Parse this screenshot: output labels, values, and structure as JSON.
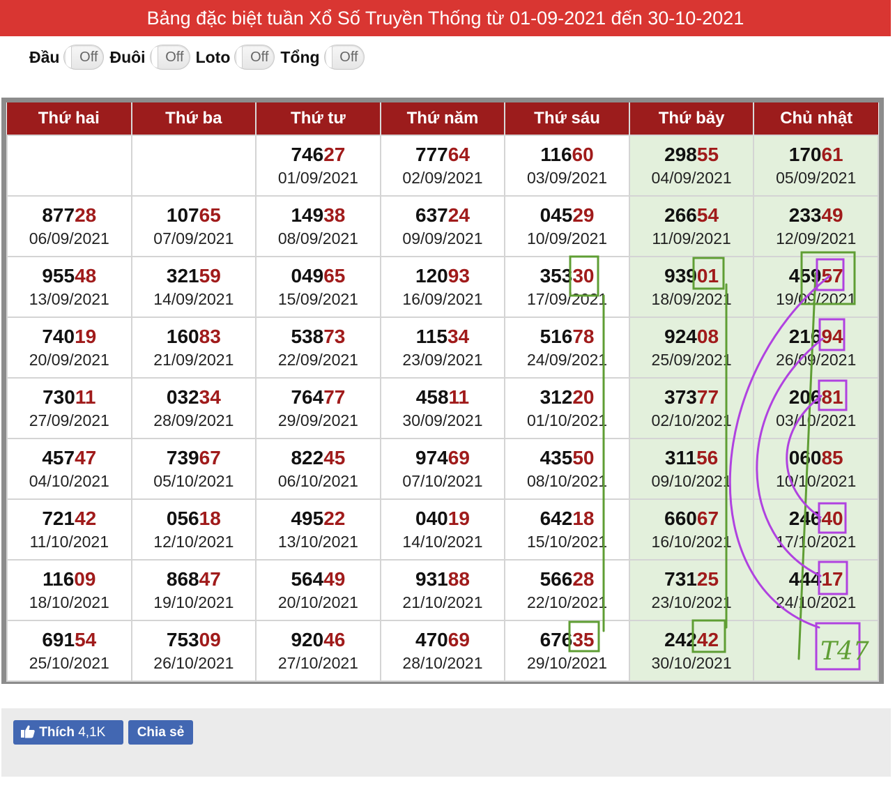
{
  "title": "Bảng đặc biệt tuần Xổ Số Truyền Thống từ 01-09-2021 đến 30-10-2021",
  "toggles": [
    {
      "label": "Đầu",
      "state": "Off"
    },
    {
      "label": "Đuôi",
      "state": "Off"
    },
    {
      "label": "Loto",
      "state": "Off"
    },
    {
      "label": "Tổng",
      "state": "Off"
    }
  ],
  "headers": [
    "Thứ hai",
    "Thứ ba",
    "Thứ tư",
    "Thứ năm",
    "Thứ sáu",
    "Thứ bảy",
    "Chủ nhật"
  ],
  "rows": [
    [
      null,
      null,
      {
        "head": "746",
        "tail": "27",
        "date": "01/09/2021"
      },
      {
        "head": "777",
        "tail": "64",
        "date": "02/09/2021"
      },
      {
        "head": "116",
        "tail": "60",
        "date": "03/09/2021"
      },
      {
        "head": "298",
        "tail": "55",
        "date": "04/09/2021"
      },
      {
        "head": "170",
        "tail": "61",
        "date": "05/09/2021"
      }
    ],
    [
      {
        "head": "877",
        "tail": "28",
        "date": "06/09/2021"
      },
      {
        "head": "107",
        "tail": "65",
        "date": "07/09/2021"
      },
      {
        "head": "149",
        "tail": "38",
        "date": "08/09/2021"
      },
      {
        "head": "637",
        "tail": "24",
        "date": "09/09/2021"
      },
      {
        "head": "045",
        "tail": "29",
        "date": "10/09/2021"
      },
      {
        "head": "266",
        "tail": "54",
        "date": "11/09/2021"
      },
      {
        "head": "233",
        "tail": "49",
        "date": "12/09/2021"
      }
    ],
    [
      {
        "head": "955",
        "tail": "48",
        "date": "13/09/2021"
      },
      {
        "head": "321",
        "tail": "59",
        "date": "14/09/2021"
      },
      {
        "head": "049",
        "tail": "65",
        "date": "15/09/2021"
      },
      {
        "head": "120",
        "tail": "93",
        "date": "16/09/2021"
      },
      {
        "head": "353",
        "tail": "30",
        "date": "17/09/2021"
      },
      {
        "head": "939",
        "tail": "01",
        "date": "18/09/2021"
      },
      {
        "head": "459",
        "tail": "57",
        "date": "19/09/2021"
      }
    ],
    [
      {
        "head": "740",
        "tail": "19",
        "date": "20/09/2021"
      },
      {
        "head": "160",
        "tail": "83",
        "date": "21/09/2021"
      },
      {
        "head": "538",
        "tail": "73",
        "date": "22/09/2021"
      },
      {
        "head": "115",
        "tail": "34",
        "date": "23/09/2021"
      },
      {
        "head": "516",
        "tail": "78",
        "date": "24/09/2021"
      },
      {
        "head": "924",
        "tail": "08",
        "date": "25/09/2021"
      },
      {
        "head": "216",
        "tail": "94",
        "date": "26/09/2021"
      }
    ],
    [
      {
        "head": "730",
        "tail": "11",
        "date": "27/09/2021"
      },
      {
        "head": "032",
        "tail": "34",
        "date": "28/09/2021"
      },
      {
        "head": "764",
        "tail": "77",
        "date": "29/09/2021"
      },
      {
        "head": "458",
        "tail": "11",
        "date": "30/09/2021"
      },
      {
        "head": "312",
        "tail": "20",
        "date": "01/10/2021"
      },
      {
        "head": "373",
        "tail": "77",
        "date": "02/10/2021"
      },
      {
        "head": "206",
        "tail": "81",
        "date": "03/10/2021"
      }
    ],
    [
      {
        "head": "457",
        "tail": "47",
        "date": "04/10/2021"
      },
      {
        "head": "739",
        "tail": "67",
        "date": "05/10/2021"
      },
      {
        "head": "822",
        "tail": "45",
        "date": "06/10/2021"
      },
      {
        "head": "974",
        "tail": "69",
        "date": "07/10/2021"
      },
      {
        "head": "435",
        "tail": "50",
        "date": "08/10/2021"
      },
      {
        "head": "311",
        "tail": "56",
        "date": "09/10/2021"
      },
      {
        "head": "060",
        "tail": "85",
        "date": "10/10/2021"
      }
    ],
    [
      {
        "head": "721",
        "tail": "42",
        "date": "11/10/2021"
      },
      {
        "head": "056",
        "tail": "18",
        "date": "12/10/2021"
      },
      {
        "head": "495",
        "tail": "22",
        "date": "13/10/2021"
      },
      {
        "head": "040",
        "tail": "19",
        "date": "14/10/2021"
      },
      {
        "head": "642",
        "tail": "18",
        "date": "15/10/2021"
      },
      {
        "head": "660",
        "tail": "67",
        "date": "16/10/2021"
      },
      {
        "head": "246",
        "tail": "40",
        "date": "17/10/2021"
      }
    ],
    [
      {
        "head": "116",
        "tail": "09",
        "date": "18/10/2021"
      },
      {
        "head": "868",
        "tail": "47",
        "date": "19/10/2021"
      },
      {
        "head": "564",
        "tail": "49",
        "date": "20/10/2021"
      },
      {
        "head": "931",
        "tail": "88",
        "date": "21/10/2021"
      },
      {
        "head": "566",
        "tail": "28",
        "date": "22/10/2021"
      },
      {
        "head": "731",
        "tail": "25",
        "date": "23/10/2021"
      },
      {
        "head": "444",
        "tail": "17",
        "date": "24/10/2021"
      }
    ],
    [
      {
        "head": "691",
        "tail": "54",
        "date": "25/10/2021"
      },
      {
        "head": "753",
        "tail": "09",
        "date": "26/10/2021"
      },
      {
        "head": "920",
        "tail": "46",
        "date": "27/10/2021"
      },
      {
        "head": "470",
        "tail": "69",
        "date": "28/10/2021"
      },
      {
        "head": "676",
        "tail": "35",
        "date": "29/10/2021"
      },
      {
        "head": "242",
        "tail": "42",
        "date": "30/10/2021"
      },
      null
    ]
  ],
  "annotation_text": "T47",
  "colors": {
    "title_bg": "#d93632",
    "header_bg": "#9c1c1c",
    "tail_digits": "#a01b1b",
    "weekend_bg": "#e3f0dc",
    "annotation_green": "#5f9e34",
    "annotation_purple": "#b042e0",
    "facebook_blue": "#4267b2"
  },
  "social": {
    "like_label": "Thích",
    "like_count": "4,1K",
    "share_label": "Chia sẻ"
  }
}
